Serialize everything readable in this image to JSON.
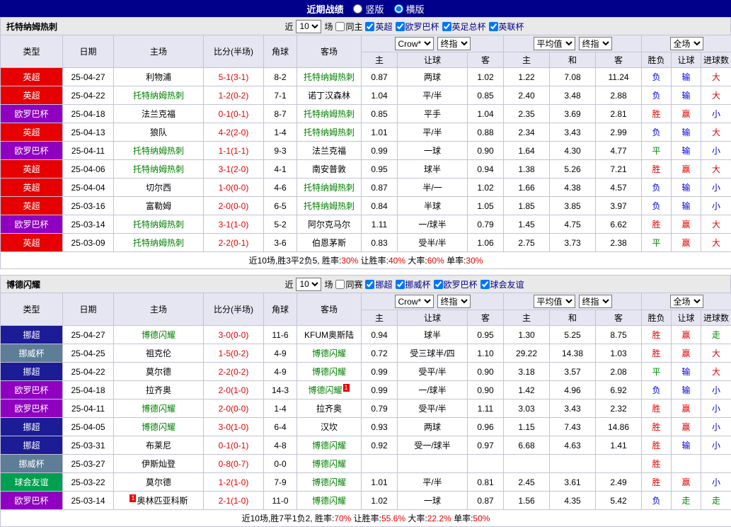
{
  "top_bar": {
    "title": "近期战绩",
    "layout_options": [
      {
        "label": "竖版",
        "selected": false
      },
      {
        "label": "横版",
        "selected": true
      }
    ]
  },
  "colors": {
    "score": "#e80000",
    "focal_team": "#008000",
    "league": {
      "英超": "#e60000",
      "欧罗巴杯": "#9000c0",
      "挪超": "#1c1c96",
      "挪威杯": "#5e7d96",
      "球会友谊": "#00a050"
    },
    "result": {
      "胜": "#e80000",
      "赢": "#e80000",
      "大": "#e80000",
      "负": "#0000e0",
      "输": "#0000e0",
      "小": "#0000e0",
      "平": "#008800",
      "走": "#008800"
    }
  },
  "table_header": {
    "col_type": "类型",
    "col_date": "日期",
    "col_home": "主场",
    "col_score": "比分(半场)",
    "col_corner": "角球",
    "col_away": "客场",
    "company_select": "Crow*",
    "final_select": "终指",
    "avg_select": "平均值",
    "avg_final_select": "终指",
    "fulltime_select": "全场",
    "sub_home": "主",
    "sub_handicap": "让球",
    "sub_away": "客",
    "sub_avg_home": "主",
    "sub_avg_draw": "和",
    "sub_avg_away": "客",
    "sub_result": "胜负",
    "sub_result_handicap": "让球",
    "sub_result_goals": "进球数"
  },
  "sections": [
    {
      "team": "托特纳姆热刺",
      "filter": {
        "near_label": "近",
        "count": "10",
        "games_label": "场",
        "same_label": "同主",
        "same_checked": false,
        "leagues": [
          {
            "label": "英超",
            "checked": true
          },
          {
            "label": "欧罗巴杯",
            "checked": true
          },
          {
            "label": "英足总杯",
            "checked": true
          },
          {
            "label": "英联杯",
            "checked": true
          }
        ]
      },
      "rows": [
        {
          "type": "英超",
          "date": "25-04-27",
          "home": "利物浦",
          "home_focal": false,
          "score": "5-1(3-1)",
          "corner": "8-2",
          "away": "托特纳姆热刺",
          "away_focal": true,
          "o1": "0.87",
          "handicap": "两球",
          "o2": "1.02",
          "a1": "1.22",
          "a2": "7.08",
          "a3": "11.24",
          "r1": "负",
          "r2": "输",
          "r3": "大"
        },
        {
          "type": "英超",
          "date": "25-04-22",
          "home": "托特纳姆热刺",
          "home_focal": true,
          "score": "1-2(0-2)",
          "corner": "7-1",
          "away": "诺丁汉森林",
          "away_focal": false,
          "o1": "1.04",
          "handicap": "平/半",
          "o2": "0.85",
          "a1": "2.40",
          "a2": "3.48",
          "a3": "2.88",
          "r1": "负",
          "r2": "输",
          "r3": "大"
        },
        {
          "type": "欧罗巴杯",
          "date": "25-04-18",
          "home": "法兰克福",
          "home_focal": false,
          "score": "0-1(0-1)",
          "corner": "8-7",
          "away": "托特纳姆热刺",
          "away_focal": true,
          "o1": "0.85",
          "handicap": "平手",
          "o2": "1.04",
          "a1": "2.35",
          "a2": "3.69",
          "a3": "2.81",
          "r1": "胜",
          "r2": "赢",
          "r3": "小"
        },
        {
          "type": "英超",
          "date": "25-04-13",
          "home": "狼队",
          "home_focal": false,
          "score": "4-2(2-0)",
          "corner": "1-4",
          "away": "托特纳姆热刺",
          "away_focal": true,
          "o1": "1.01",
          "handicap": "平/半",
          "o2": "0.88",
          "a1": "2.34",
          "a2": "3.43",
          "a3": "2.99",
          "r1": "负",
          "r2": "输",
          "r3": "大"
        },
        {
          "type": "欧罗巴杯",
          "date": "25-04-11",
          "home": "托特纳姆热刺",
          "home_focal": true,
          "score": "1-1(1-1)",
          "corner": "9-3",
          "away": "法兰克福",
          "away_focal": false,
          "o1": "0.99",
          "handicap": "一球",
          "o2": "0.90",
          "a1": "1.64",
          "a2": "4.30",
          "a3": "4.77",
          "r1": "平",
          "r2": "输",
          "r3": "小"
        },
        {
          "type": "英超",
          "date": "25-04-06",
          "home": "托特纳姆热刺",
          "home_focal": true,
          "score": "3-1(2-0)",
          "corner": "4-1",
          "away": "南安普敦",
          "away_focal": false,
          "o1": "0.95",
          "handicap": "球半",
          "o2": "0.94",
          "a1": "1.38",
          "a2": "5.26",
          "a3": "7.21",
          "r1": "胜",
          "r2": "赢",
          "r3": "大"
        },
        {
          "type": "英超",
          "date": "25-04-04",
          "home": "切尔西",
          "home_focal": false,
          "score": "1-0(0-0)",
          "corner": "4-6",
          "away": "托特纳姆热刺",
          "away_focal": true,
          "o1": "0.87",
          "handicap": "半/一",
          "o2": "1.02",
          "a1": "1.66",
          "a2": "4.38",
          "a3": "4.57",
          "r1": "负",
          "r2": "输",
          "r3": "小"
        },
        {
          "type": "英超",
          "date": "25-03-16",
          "home": "富勒姆",
          "home_focal": false,
          "score": "2-0(0-0)",
          "corner": "6-5",
          "away": "托特纳姆热刺",
          "away_focal": true,
          "o1": "0.84",
          "handicap": "半球",
          "o2": "1.05",
          "a1": "1.85",
          "a2": "3.85",
          "a3": "3.97",
          "r1": "负",
          "r2": "输",
          "r3": "小"
        },
        {
          "type": "欧罗巴杯",
          "date": "25-03-14",
          "home": "托特纳姆热刺",
          "home_focal": true,
          "score": "3-1(1-0)",
          "corner": "5-2",
          "away": "阿尔克马尔",
          "away_focal": false,
          "o1": "1.11",
          "handicap": "一/球半",
          "o2": "0.79",
          "a1": "1.45",
          "a2": "4.75",
          "a3": "6.62",
          "r1": "胜",
          "r2": "赢",
          "r3": "大"
        },
        {
          "type": "英超",
          "date": "25-03-09",
          "home": "托特纳姆热刺",
          "home_focal": true,
          "score": "2-2(0-1)",
          "corner": "3-6",
          "away": "伯恩茅斯",
          "away_focal": false,
          "o1": "0.83",
          "handicap": "受半/半",
          "o2": "1.06",
          "a1": "2.75",
          "a2": "3.73",
          "a3": "2.38",
          "r1": "平",
          "r2": "赢",
          "r3": "大"
        }
      ],
      "summary": [
        {
          "t": "近10场,胜3平2负5, 胜率:"
        },
        {
          "t": "30%",
          "red": true
        },
        {
          "t": " 让胜率:"
        },
        {
          "t": "40%",
          "red": true
        },
        {
          "t": " 大率:"
        },
        {
          "t": "60%",
          "red": true
        },
        {
          "t": " 单率:"
        },
        {
          "t": "30%",
          "red": true
        }
      ]
    },
    {
      "team": "博德闪耀",
      "filter": {
        "near_label": "近",
        "count": "10",
        "games_label": "场",
        "same_label": "同赛",
        "same_checked": false,
        "leagues": [
          {
            "label": "挪超",
            "checked": true
          },
          {
            "label": "挪威杯",
            "checked": true
          },
          {
            "label": "欧罗巴杯",
            "checked": true
          },
          {
            "label": "球会友谊",
            "checked": true
          }
        ]
      },
      "rows": [
        {
          "type": "挪超",
          "date": "25-04-27",
          "home": "博德闪耀",
          "home_focal": true,
          "score": "3-0(0-0)",
          "corner": "11-6",
          "away": "KFUM奥斯陆",
          "away_focal": false,
          "o1": "0.94",
          "handicap": "球半",
          "o2": "0.95",
          "a1": "1.30",
          "a2": "5.25",
          "a3": "8.75",
          "r1": "胜",
          "r2": "赢",
          "r3": "走"
        },
        {
          "type": "挪威杯",
          "date": "25-04-25",
          "home": "祖克伦",
          "home_focal": false,
          "score": "1-5(0-2)",
          "corner": "4-9",
          "away": "博德闪耀",
          "away_focal": true,
          "o1": "0.72",
          "handicap": "受三球半/四",
          "o2": "1.10",
          "a1": "29.22",
          "a2": "14.38",
          "a3": "1.03",
          "r1": "胜",
          "r2": "赢",
          "r3": "大"
        },
        {
          "type": "挪超",
          "date": "25-04-22",
          "home": "莫尔德",
          "home_focal": false,
          "score": "2-2(0-2)",
          "corner": "4-9",
          "away": "博德闪耀",
          "away_focal": true,
          "o1": "0.99",
          "handicap": "受平/半",
          "o2": "0.90",
          "a1": "3.18",
          "a2": "3.57",
          "a3": "2.08",
          "r1": "平",
          "r2": "输",
          "r3": "大"
        },
        {
          "type": "欧罗巴杯",
          "date": "25-04-18",
          "home": "拉齐奥",
          "home_focal": false,
          "score": "2-0(1-0)",
          "corner": "14-3",
          "away": "博德闪耀",
          "away_focal": true,
          "away_card": "1",
          "away_card_pos": "after",
          "o1": "0.99",
          "handicap": "一/球半",
          "o2": "0.90",
          "a1": "1.42",
          "a2": "4.96",
          "a3": "6.92",
          "r1": "负",
          "r2": "输",
          "r3": "小"
        },
        {
          "type": "欧罗巴杯",
          "date": "25-04-11",
          "home": "博德闪耀",
          "home_focal": true,
          "score": "2-0(0-0)",
          "corner": "1-4",
          "away": "拉齐奥",
          "away_focal": false,
          "o1": "0.79",
          "handicap": "受平/半",
          "o2": "1.11",
          "a1": "3.03",
          "a2": "3.43",
          "a3": "2.32",
          "r1": "胜",
          "r2": "赢",
          "r3": "小"
        },
        {
          "type": "挪超",
          "date": "25-04-05",
          "home": "博德闪耀",
          "home_focal": true,
          "score": "3-0(1-0)",
          "corner": "6-4",
          "away": "汉坎",
          "away_focal": false,
          "o1": "0.93",
          "handicap": "两球",
          "o2": "0.96",
          "a1": "1.15",
          "a2": "7.43",
          "a3": "14.86",
          "r1": "胜",
          "r2": "赢",
          "r3": "小"
        },
        {
          "type": "挪超",
          "date": "25-03-31",
          "home": "布莱尼",
          "home_focal": false,
          "score": "0-1(0-1)",
          "corner": "4-8",
          "away": "博德闪耀",
          "away_focal": true,
          "o1": "0.92",
          "handicap": "受一/球半",
          "o2": "0.97",
          "a1": "6.68",
          "a2": "4.63",
          "a3": "1.41",
          "r1": "胜",
          "r2": "输",
          "r3": "小"
        },
        {
          "type": "挪威杯",
          "date": "25-03-27",
          "home": "伊斯灿登",
          "home_focal": false,
          "score": "0-8(0-7)",
          "corner": "0-0",
          "away": "博德闪耀",
          "away_focal": true,
          "o1": "",
          "handicap": "",
          "o2": "",
          "a1": "",
          "a2": "",
          "a3": "",
          "r1": "胜",
          "r2": "",
          "r3": ""
        },
        {
          "type": "球会友谊",
          "date": "25-03-22",
          "home": "莫尔德",
          "home_focal": false,
          "score": "1-2(1-0)",
          "corner": "7-9",
          "away": "博德闪耀",
          "away_focal": true,
          "o1": "1.01",
          "handicap": "平/半",
          "o2": "0.81",
          "a1": "2.45",
          "a2": "3.61",
          "a3": "2.49",
          "r1": "胜",
          "r2": "赢",
          "r3": "小"
        },
        {
          "type": "欧罗巴杯",
          "date": "25-03-14",
          "home": "奥林匹亚科斯",
          "home_focal": false,
          "home_card": "1",
          "home_card_pos": "before",
          "score": "2-1(1-0)",
          "corner": "11-0",
          "away": "博德闪耀",
          "away_focal": true,
          "o1": "1.02",
          "handicap": "一球",
          "o2": "0.87",
          "a1": "1.56",
          "a2": "4.35",
          "a3": "5.42",
          "r1": "负",
          "r2": "走",
          "r3": "走"
        }
      ],
      "summary": [
        {
          "t": "近10场,胜7平1负2, 胜率:"
        },
        {
          "t": "70%",
          "red": true
        },
        {
          "t": " 让胜率:"
        },
        {
          "t": "55.6%",
          "red": true
        },
        {
          "t": " 大率:"
        },
        {
          "t": "22.2%",
          "red": true
        },
        {
          "t": " 单率:"
        },
        {
          "t": "50%",
          "red": true
        }
      ]
    }
  ]
}
